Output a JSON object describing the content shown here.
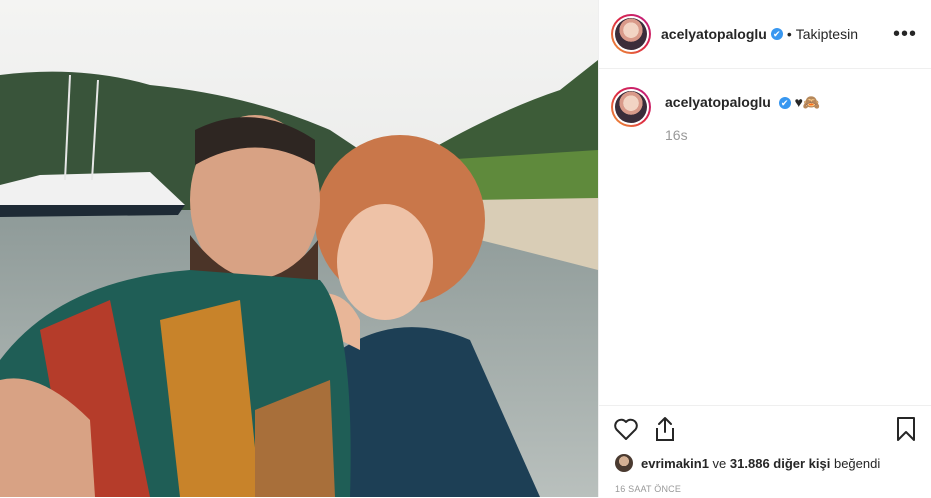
{
  "header": {
    "username": "acelyatopaloglu",
    "verified_mark": "✔",
    "separator": "•",
    "follow_status": "Takiptesin",
    "more_label": "•••"
  },
  "caption": {
    "username": "acelyatopaloglu",
    "verified_mark": "✔",
    "text": "♥🙈",
    "time": "16s"
  },
  "actions": {
    "icons": [
      "heart-icon",
      "share-icon",
      "bookmark-icon"
    ]
  },
  "likes": {
    "user": "evrimakin1",
    "middle": " ve ",
    "count_text": "31.886 diğer kişi",
    "suffix": " beğendi"
  },
  "timestamp": "16 SAAT ÖNCE",
  "colors": {
    "verified_blue": "#3897f0",
    "border": "#efefef",
    "muted": "#999999",
    "text": "#262626"
  }
}
